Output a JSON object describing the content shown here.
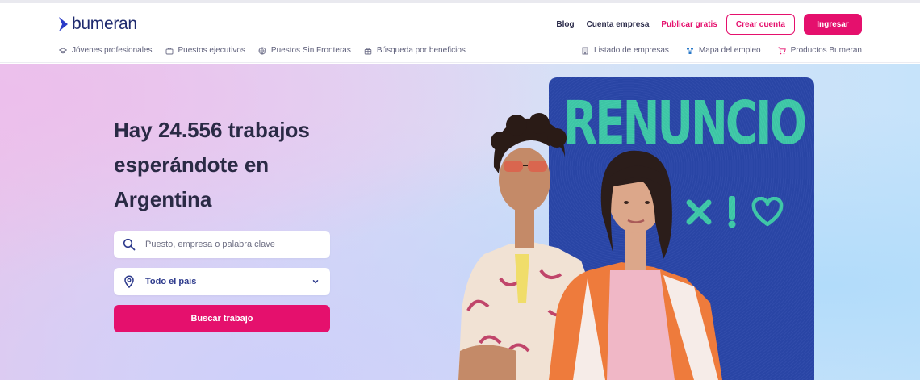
{
  "brand": {
    "name": "bumeran",
    "accent": "#e5106d",
    "navy": "#1e2a6e"
  },
  "topnav": {
    "links": [
      "Blog",
      "Cuenta empresa"
    ],
    "publish": "Publicar gratis",
    "create_account": "Crear cuenta",
    "login": "Ingresar"
  },
  "subnav_left": [
    {
      "label": "Jóvenes profesionales",
      "icon": "graduation-cap-icon"
    },
    {
      "label": "Puestos ejecutivos",
      "icon": "briefcase-icon"
    },
    {
      "label": "Puestos Sin Fronteras",
      "icon": "globe-icon"
    },
    {
      "label": "Búsqueda por beneficios",
      "icon": "gift-icon"
    }
  ],
  "subnav_right": [
    {
      "label": "Listado de empresas",
      "icon": "building-icon"
    },
    {
      "label": "Mapa del empleo",
      "icon": "map-tree-icon"
    },
    {
      "label": "Productos Bumeran",
      "icon": "cart-icon"
    }
  ],
  "hero": {
    "headline_pre": "Hay",
    "job_count": "24.556",
    "headline_mid": "trabajos",
    "headline_line2": "esperándote en",
    "headline_line3": "Argentina",
    "search_placeholder": "Puesto, empresa o palabra clave",
    "location_value": "Todo el país",
    "search_button": "Buscar trabajo"
  },
  "promo": {
    "word": "RENUNCIO",
    "symbols": [
      "close-x-icon",
      "exclamation-icon",
      "heart-icon"
    ],
    "background": "#2a46a8",
    "text_color": "#3ec9a8"
  }
}
